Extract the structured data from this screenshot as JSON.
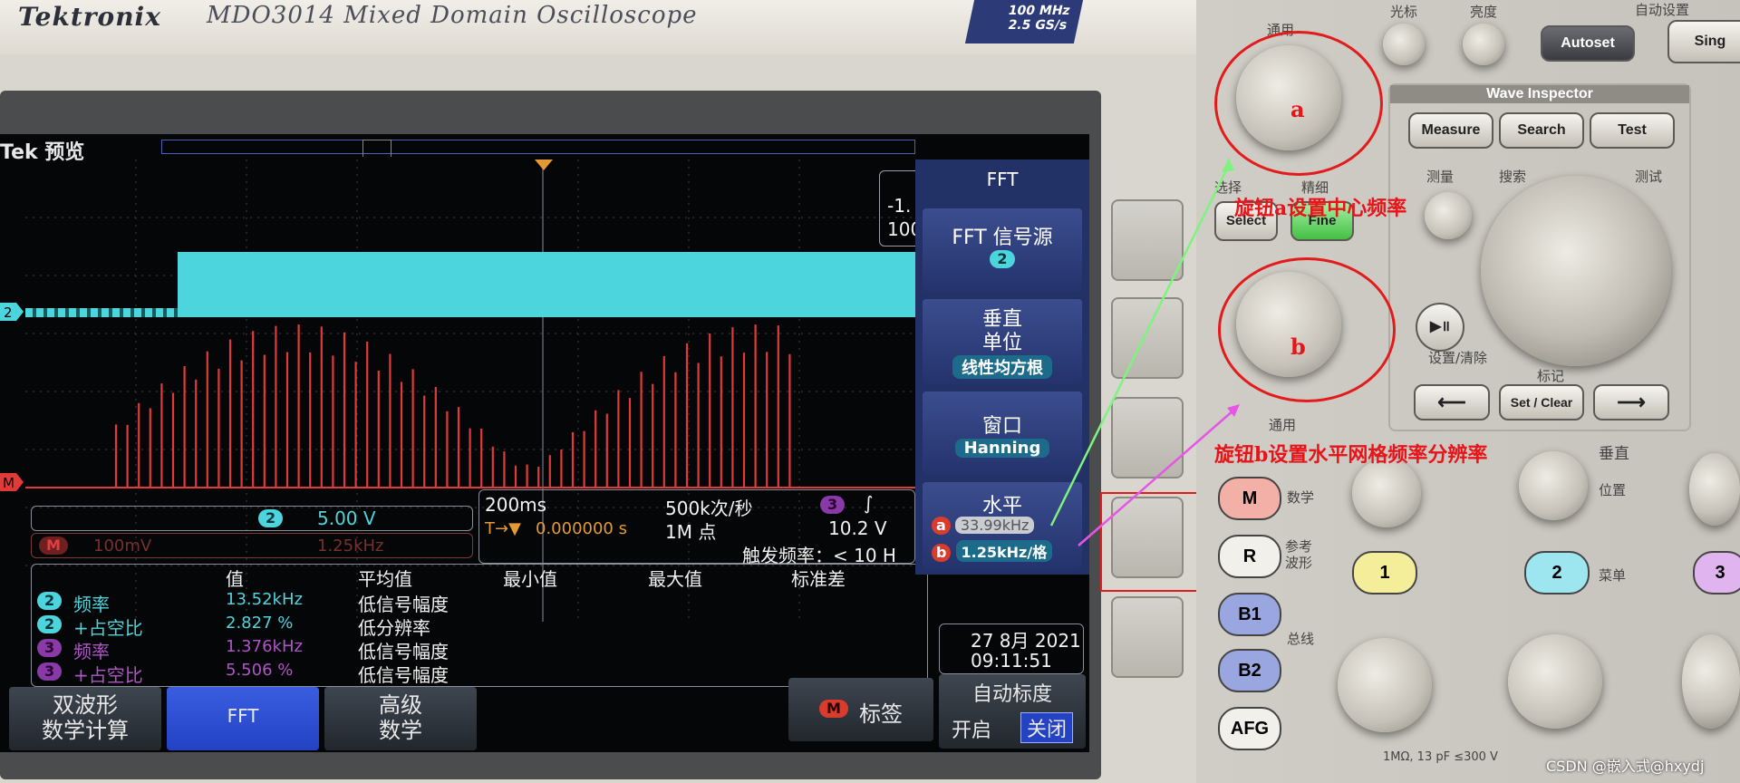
{
  "device": {
    "brand": "Tektronix",
    "model": "MDO3014 Mixed Domain Oscilloscope",
    "spec_line1": "100 MHz",
    "spec_line2": "2.5 GS/s"
  },
  "screen": {
    "header": "Tek 预览",
    "channel_readout": {
      "channel": "2",
      "scale": "5.00 V"
    },
    "math_readout": {
      "label": "M",
      "scale": "100mV",
      "freq": "1.25kHz"
    },
    "timebase": {
      "time_per_div": "200ms",
      "sample_rate": "500k次/秒",
      "delay": "0.000000 s",
      "points": "1M 点",
      "trigger_channel": "3",
      "trigger_level": "10.2 V",
      "trigger_freq": "触发频率：< 10 H"
    },
    "partial_readout_line1": "-1.",
    "partial_readout_line2": "100",
    "measurements": {
      "headers": [
        "值",
        "平均值",
        "最小值",
        "最大值",
        "标准差"
      ],
      "rows": [
        {
          "ch": "2",
          "name": "频率",
          "value": "13.52kHz",
          "note": "低信号幅度"
        },
        {
          "ch": "2",
          "name": "+占空比",
          "value": "2.827 %",
          "note": "低分辨率"
        },
        {
          "ch": "3",
          "name": "频率",
          "value": "1.376kHz",
          "note": "低信号幅度"
        },
        {
          "ch": "3",
          "name": "+占空比",
          "value": "5.506 %",
          "note": "低信号幅度"
        }
      ]
    },
    "datetime": {
      "date": "27 8月 2021",
      "time": "09:11:51"
    },
    "side_menu": {
      "title": "FFT",
      "fft_source_label": "FFT 信号源",
      "fft_source_value": "2",
      "vertical_units_label": "垂直\n单位",
      "vertical_units_value": "线性均方根",
      "window_label": "窗口",
      "window_value": "Hanning",
      "horizontal_label": "水平",
      "knob_a_marker": "a",
      "knob_b_marker": "b",
      "center_freq": "33.99kHz",
      "freq_per_div": "1.25kHz/格"
    },
    "bottom_menu": {
      "dual_math": "双波形\n数学计算",
      "fft": "FFT",
      "advanced_math": "高级\n数学",
      "label_btn_icon": "M",
      "label_btn": "标签",
      "autoscale_label": "自动标度",
      "autoscale_on": "开启",
      "autoscale_off": "关闭"
    }
  },
  "panel": {
    "general_top": "通用",
    "cursors": "光标",
    "brightness": "亮度",
    "autoset_top": "自动设置",
    "autoset": "Autoset",
    "single": "Sing",
    "wave_inspector": "Wave Inspector",
    "measure": "Measure",
    "search": "Search",
    "test": "Test",
    "measure_cn": "测量",
    "search_cn": "搜索",
    "test_cn": "测试",
    "select_cn": "选择",
    "select": "Select",
    "fine_cn": "精细",
    "fine": "Fine",
    "set_clear_cn": "设置/清除",
    "mark_cn": "标记",
    "set_clear": "Set / Clear",
    "general_bottom": "通用",
    "vertical": "垂直",
    "position": "位置",
    "menu": "菜单",
    "math_key": "M",
    "math_cn": "数学",
    "ref_key": "R",
    "ref_cn": "参考\n波形",
    "b1": "B1",
    "b2": "B2",
    "bus_cn": "总线",
    "afg": "AFG",
    "ch1": "1",
    "ch2": "2",
    "ch3": "3",
    "bottom_spec": "1MΩ, 13 pF ≤300 V"
  },
  "annotations": {
    "knob_a": "a",
    "knob_b": "b",
    "text_a": "旋钮a设置中心频率",
    "text_b": "旋钮b设置水平网格频率分辨率"
  },
  "watermark": "CSDN @嵌入式@hxydj",
  "colors": {
    "cyan": "#4cd5dc",
    "red_trace": "#e03a3a",
    "menu_blue": "#223166",
    "annotation": "#e8141a"
  }
}
